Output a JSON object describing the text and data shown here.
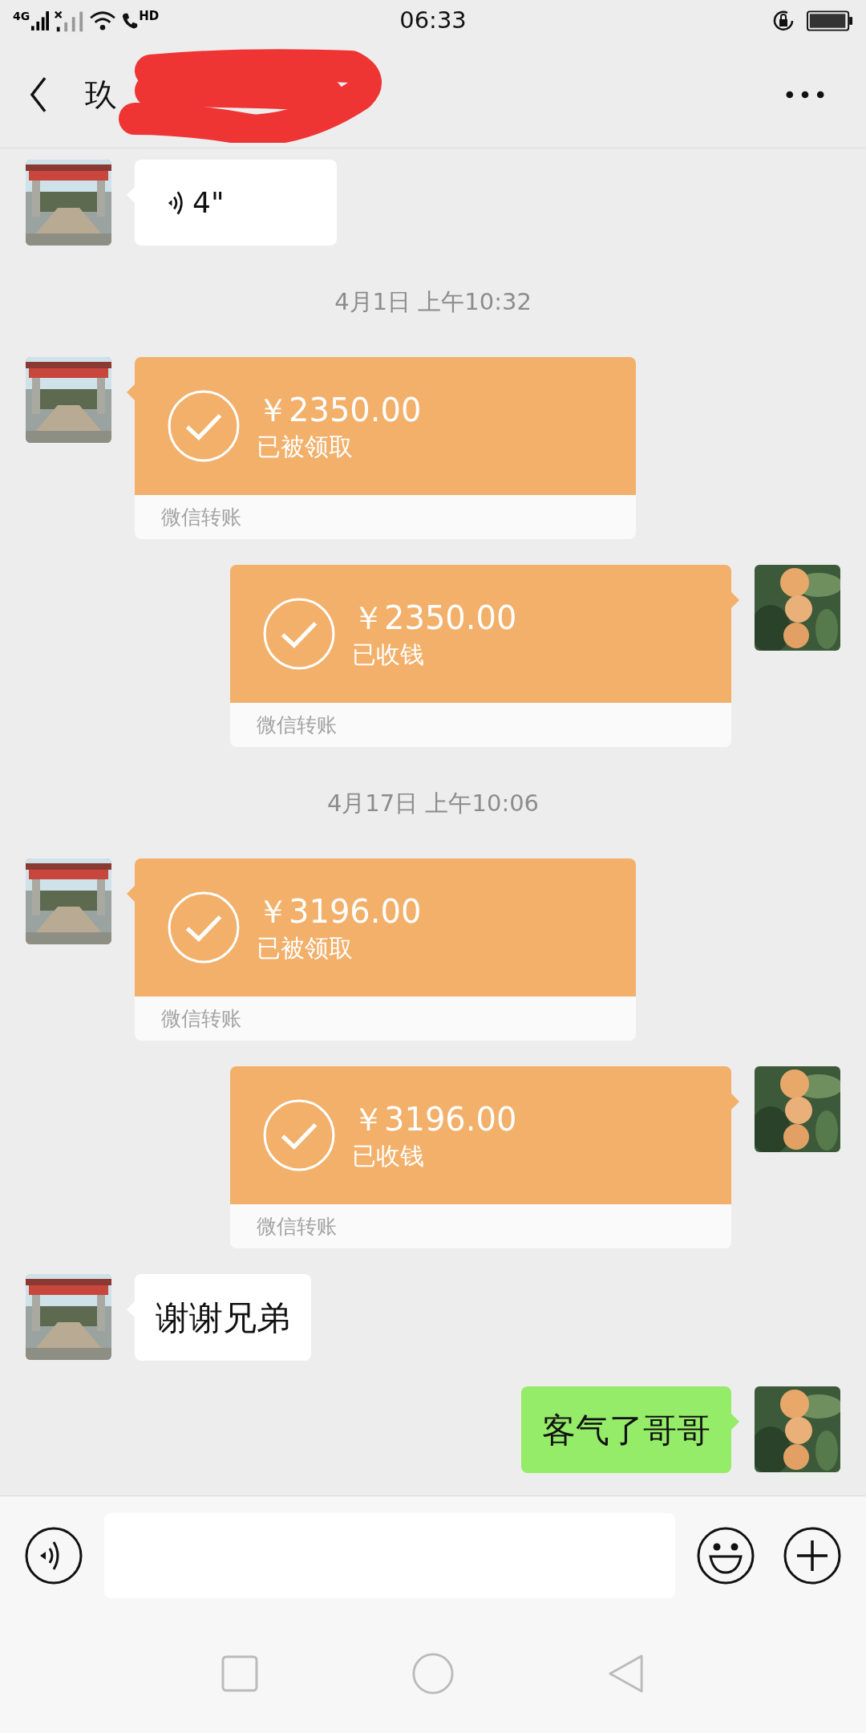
{
  "status_bar": {
    "network": "4G",
    "call": "HD",
    "time": "06:33"
  },
  "header": {
    "title": "玖"
  },
  "messages": [
    {
      "kind": "voice",
      "mine": false,
      "duration": "4\""
    },
    {
      "kind": "time",
      "text": "4月1日 上午10:32"
    },
    {
      "kind": "transfer",
      "mine": false,
      "amount": "￥2350.00",
      "status": "已被领取",
      "footer": "微信转账"
    },
    {
      "kind": "transfer",
      "mine": true,
      "amount": "￥2350.00",
      "status": "已收钱",
      "footer": "微信转账"
    },
    {
      "kind": "time",
      "text": "4月17日 上午10:06"
    },
    {
      "kind": "transfer",
      "mine": false,
      "amount": "￥3196.00",
      "status": "已被领取",
      "footer": "微信转账"
    },
    {
      "kind": "transfer",
      "mine": true,
      "amount": "￥3196.00",
      "status": "已收钱",
      "footer": "微信转账"
    },
    {
      "kind": "text",
      "mine": false,
      "text": "谢谢兄弟"
    },
    {
      "kind": "text",
      "mine": true,
      "text": "客气了哥哥"
    }
  ]
}
